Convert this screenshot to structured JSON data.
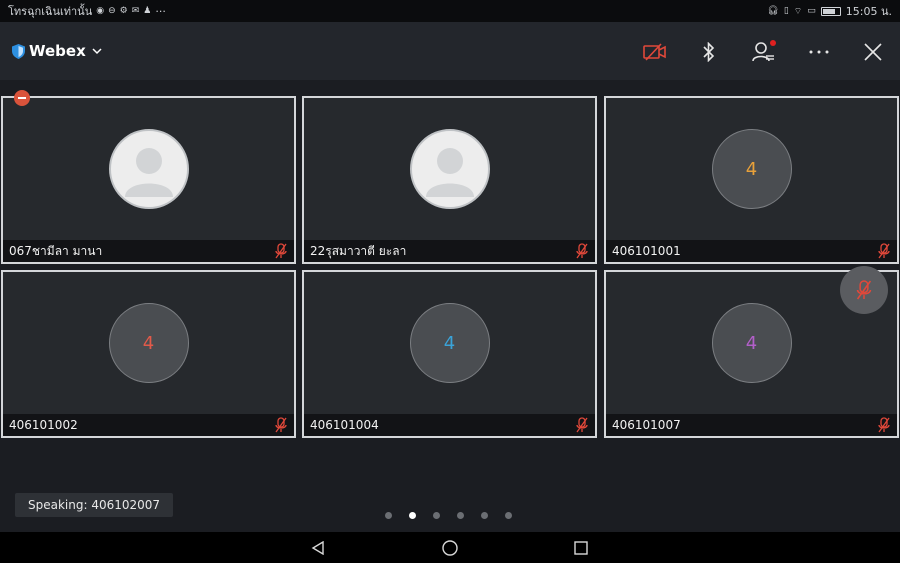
{
  "status_bar": {
    "left_text": "โทรฉุกเฉินเท่านั้น",
    "left_icons": [
      "notification-icon",
      "message-icon",
      "settings-icon",
      "gmail-icon",
      "dnd-icon"
    ],
    "more": "···",
    "time": "15:05 น."
  },
  "header": {
    "app_title": "Webex",
    "tools": [
      "camera-off-icon",
      "bluetooth-icon",
      "participants-icon",
      "more-icon",
      "close-icon"
    ],
    "accent": "#e0483a"
  },
  "tiles": [
    {
      "name": "067ชามีลา มานา",
      "avatar": "person",
      "initial": ""
    },
    {
      "name": "22รุสมาวาตี ยะลา",
      "avatar": "person",
      "initial": ""
    },
    {
      "name": "406101001",
      "avatar": "initial",
      "initial": "4",
      "initial_color": "#e8a13a"
    },
    {
      "name": "406101002",
      "avatar": "initial",
      "initial": "4",
      "initial_color": "#e25a4a"
    },
    {
      "name": "406101004",
      "avatar": "initial",
      "initial": "4",
      "initial_color": "#3aa3d8"
    },
    {
      "name": "406101007",
      "avatar": "initial",
      "initial": "4",
      "initial_color": "#b25fc9"
    }
  ],
  "speaking_label": "Speaking: 406102007",
  "pager": {
    "pages": 6,
    "active": 2
  },
  "nav": [
    "back-icon",
    "home-icon",
    "recents-icon"
  ]
}
